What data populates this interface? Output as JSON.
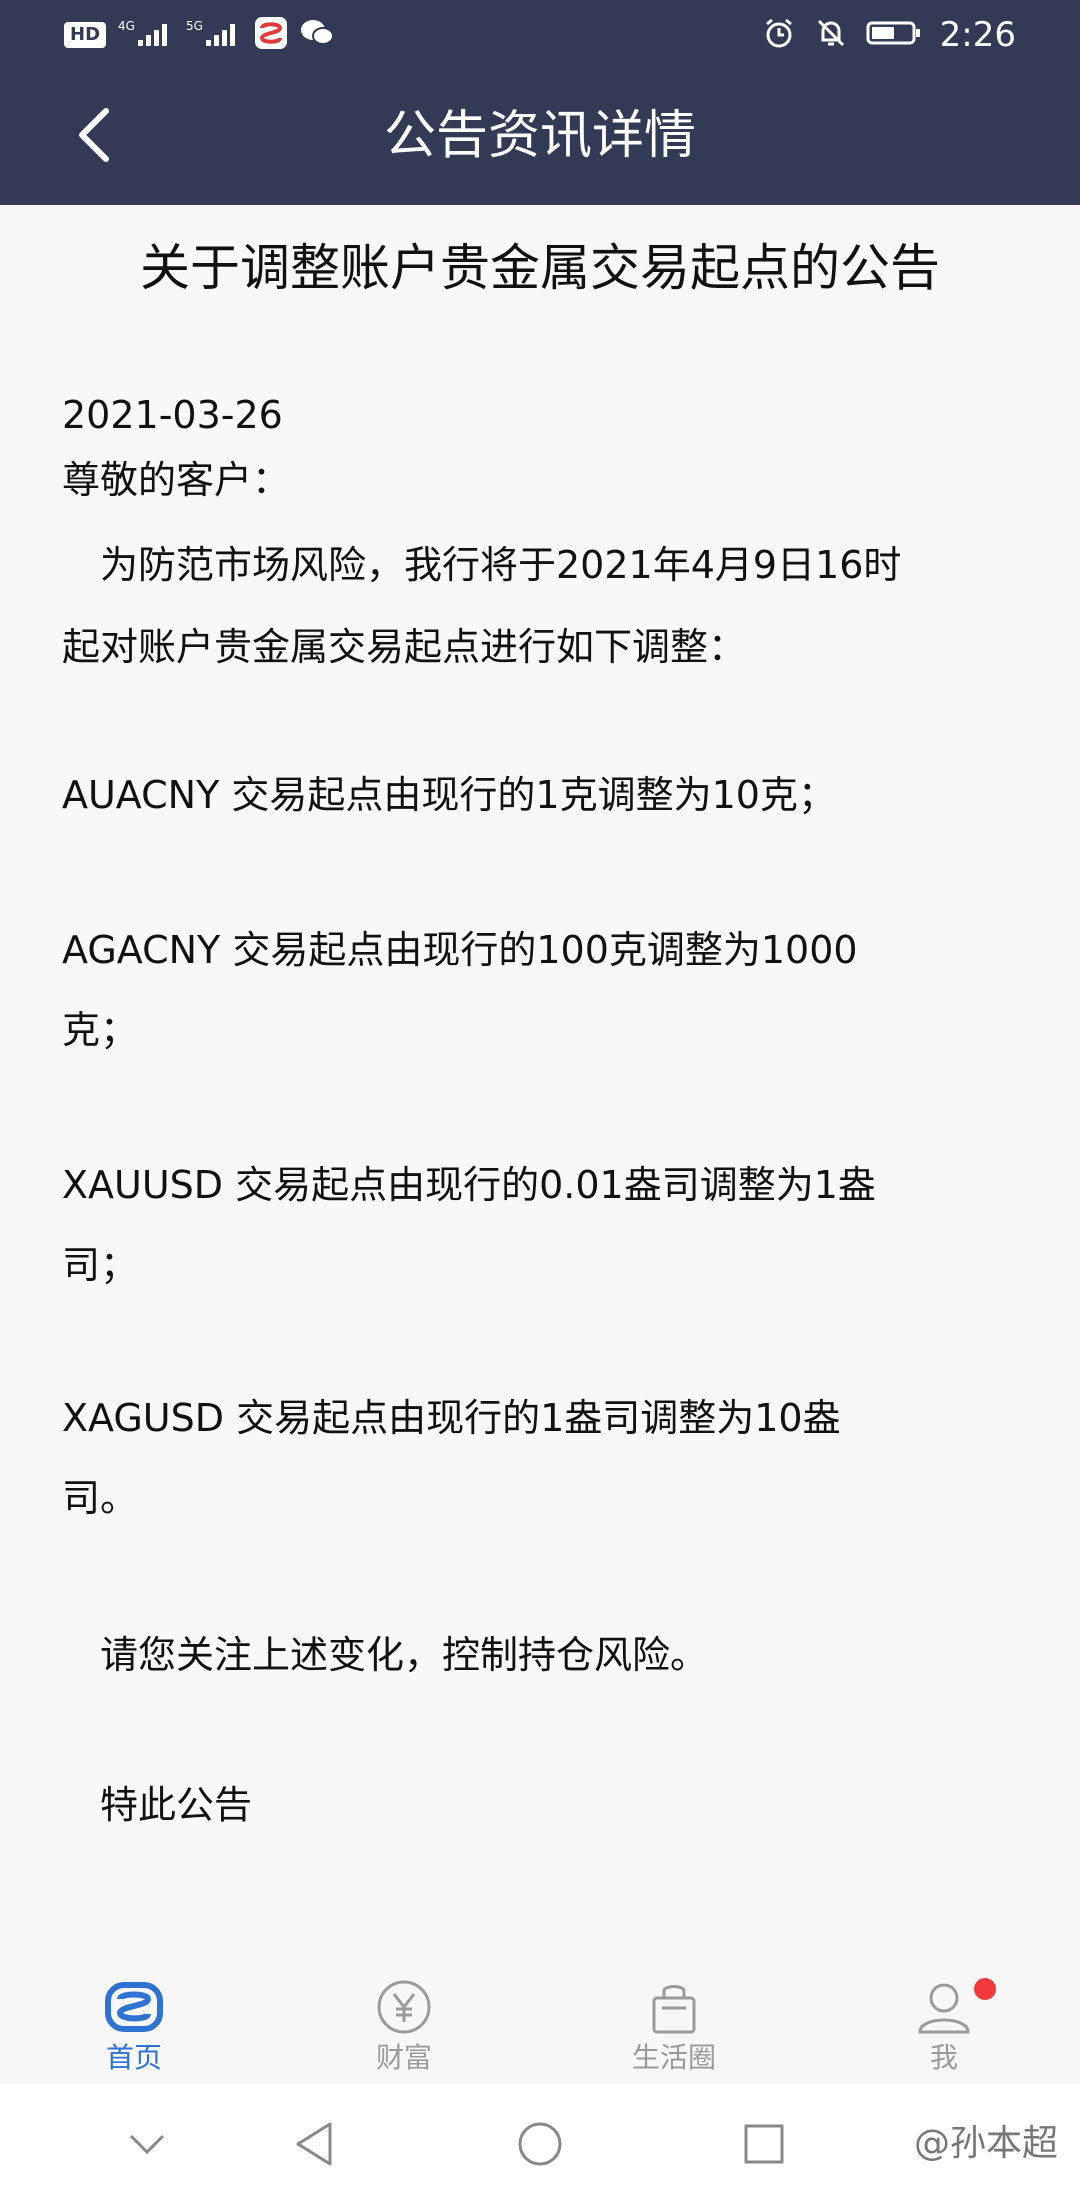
{
  "status_bar": {
    "hd": "HD",
    "net1": "4G",
    "net2": "5G",
    "time": "2:26"
  },
  "app_bar": {
    "title": "公告资讯详情"
  },
  "notice": {
    "title": "关于调整账户贵金属交易起点的公告",
    "date": "2021-03-26",
    "greeting": "尊敬的客户：",
    "intro_line1": "　为防范市场风险，我行将于2021年4月9日16时",
    "intro_line2": "起对账户贵金属交易起点进行如下调整：",
    "items": [
      {
        "line1": "AUACNY 交易起点由现行的1克调整为10克；",
        "line2": ""
      },
      {
        "line1": "AGACNY 交易起点由现行的100克调整为1000",
        "line2": "克；"
      },
      {
        "line1": "XAUUSD 交易起点由现行的0.01盎司调整为1盎",
        "line2": "司；"
      },
      {
        "line1": "XAGUSD 交易起点由现行的1盎司调整为10盎",
        "line2": "司。"
      }
    ],
    "reminder": "　请您关注上述变化，控制持仓风险。",
    "closing": "　特此公告"
  },
  "tabs": [
    {
      "label": "首页",
      "icon": "bank-logo-icon"
    },
    {
      "label": "财富",
      "icon": "yen-circle-icon"
    },
    {
      "label": "生活圈",
      "icon": "shopping-bag-icon"
    },
    {
      "label": "我",
      "icon": "user-icon"
    }
  ],
  "watermark": "@孙本超",
  "colors": {
    "header_bg": "#323a55",
    "tab_active": "#2e72d2",
    "tab_inactive": "#9a9a9a",
    "badge": "#f23a3a"
  }
}
